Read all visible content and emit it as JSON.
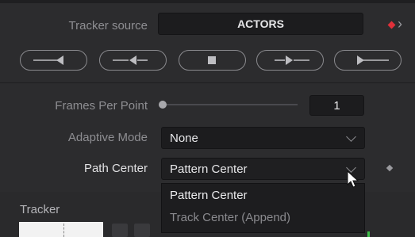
{
  "tracker_source": {
    "label": "Tracker source",
    "value": "ACTORS",
    "keyframe_color": "#e0303a",
    "nav_arrow": "›"
  },
  "track_buttons": [
    {
      "name": "track-reverse-button",
      "icon": "track-reverse-icon"
    },
    {
      "name": "track-one-frame-reverse-button",
      "icon": "track-frame-reverse-icon"
    },
    {
      "name": "stop-tracking-button",
      "icon": "stop-icon"
    },
    {
      "name": "track-one-frame-forward-button",
      "icon": "track-frame-forward-icon"
    },
    {
      "name": "track-forward-button",
      "icon": "track-forward-icon"
    }
  ],
  "frames_per_point": {
    "label": "Frames Per Point",
    "value": "1",
    "slider_fraction": 0.0
  },
  "adaptive_mode": {
    "label": "Adaptive Mode",
    "value": "None"
  },
  "path_center": {
    "label": "Path Center",
    "value": "Pattern Center",
    "options": [
      "Pattern Center",
      "Track Center (Append)"
    ],
    "highlighted_index": 0
  },
  "tracker_section": {
    "label": "Tracker"
  },
  "colors": {
    "accent_keyframe": "#e0303a",
    "tracker_green": "#3fbf4a"
  }
}
